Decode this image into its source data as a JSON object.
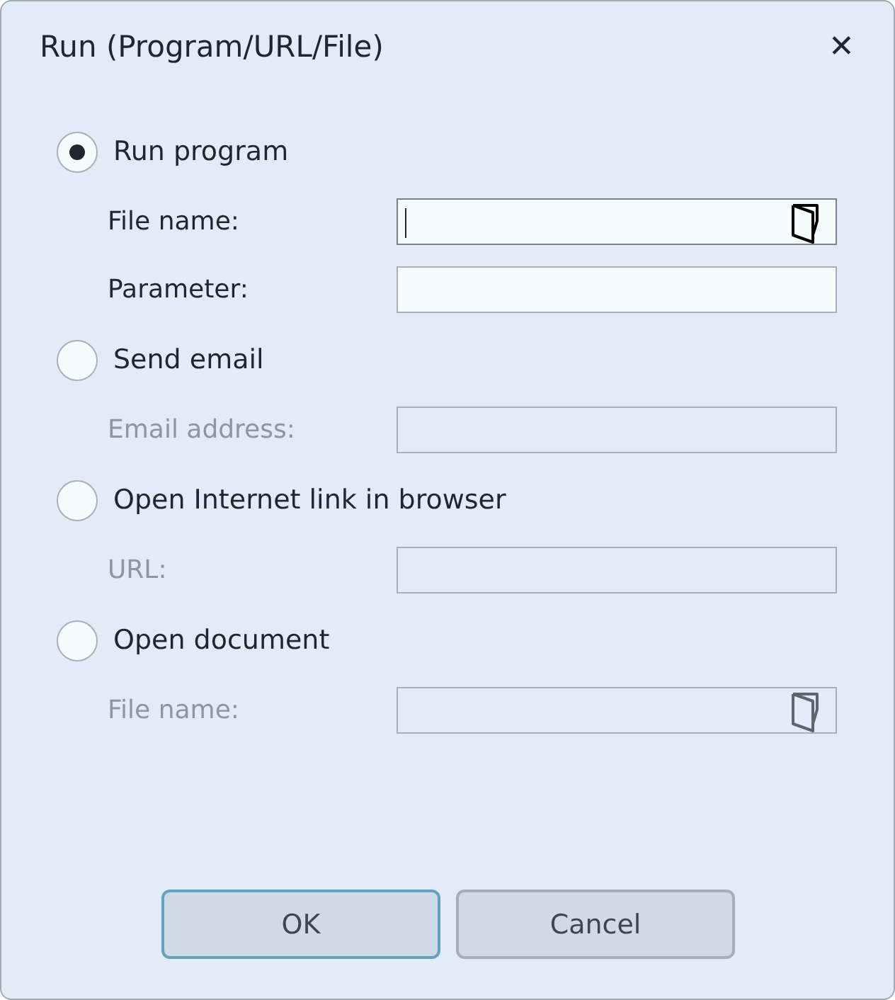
{
  "window": {
    "title": "Run (Program/URL/File)",
    "close": "✕"
  },
  "options": [
    {
      "label": "Run program",
      "selected": true,
      "fields": [
        {
          "label": "File name:",
          "disabled": false,
          "focused": true,
          "browse": true
        },
        {
          "label": "Parameter:",
          "disabled": false,
          "focused": false,
          "browse": false
        }
      ]
    },
    {
      "label": "Send email",
      "selected": false,
      "fields": [
        {
          "label": "Email address:",
          "disabled": true,
          "focused": false,
          "browse": false
        }
      ]
    },
    {
      "label": "Open Internet link in browser",
      "selected": false,
      "fields": [
        {
          "label": "URL:",
          "disabled": true,
          "focused": false,
          "browse": false
        }
      ]
    },
    {
      "label": "Open document",
      "selected": false,
      "fields": [
        {
          "label": "File name:",
          "disabled": true,
          "focused": false,
          "browse": true
        }
      ]
    }
  ],
  "buttons": [
    {
      "label": "OK",
      "default": true
    },
    {
      "label": "Cancel",
      "default": false
    }
  ]
}
